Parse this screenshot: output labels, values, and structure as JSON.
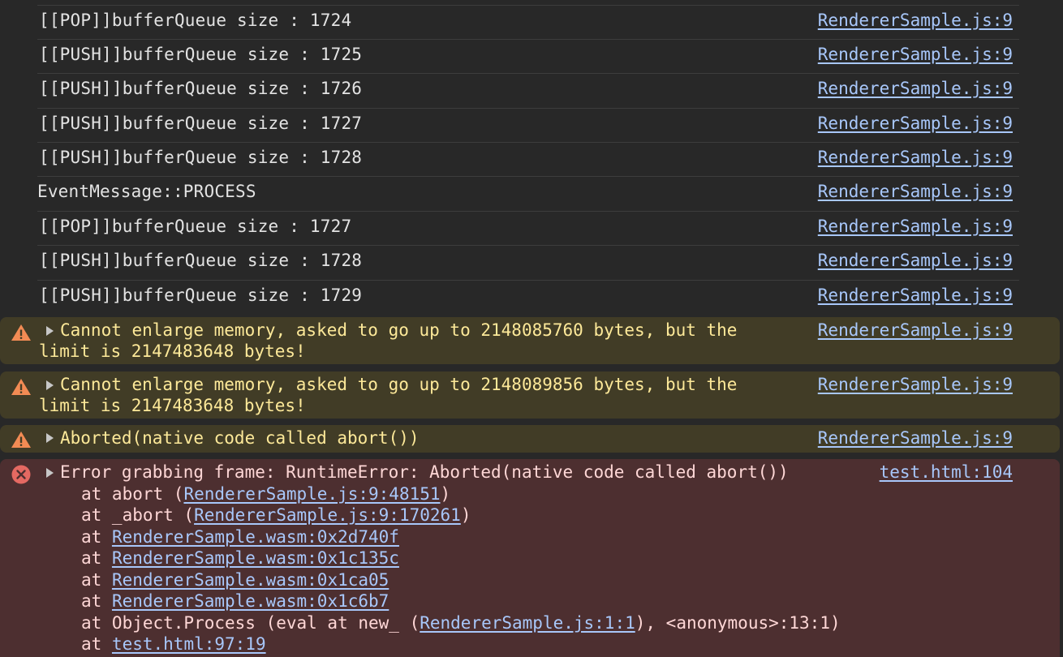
{
  "colors": {
    "background": "#282828",
    "text": "#e3e3e3",
    "link": "#a8c7fa",
    "warning_bg": "#413c26",
    "warning_text": "#fde999",
    "warning_icon": "#f28b54",
    "error_bg": "#4d2f30",
    "error_text": "#fed7d6",
    "error_icon": "#e46962"
  },
  "logs": [
    {
      "message": "[[POP]]bufferQueue size : 1724",
      "source": "RendererSample.js:9"
    },
    {
      "message": "[[PUSH]]bufferQueue size : 1725",
      "source": "RendererSample.js:9"
    },
    {
      "message": "[[PUSH]]bufferQueue size : 1726",
      "source": "RendererSample.js:9"
    },
    {
      "message": "[[PUSH]]bufferQueue size : 1727",
      "source": "RendererSample.js:9"
    },
    {
      "message": "[[PUSH]]bufferQueue size : 1728",
      "source": "RendererSample.js:9"
    },
    {
      "message": "EventMessage::PROCESS",
      "source": "RendererSample.js:9"
    },
    {
      "message": "[[POP]]bufferQueue size : 1727",
      "source": "RendererSample.js:9"
    },
    {
      "message": "[[PUSH]]bufferQueue size : 1728",
      "source": "RendererSample.js:9"
    },
    {
      "message": "[[PUSH]]bufferQueue size : 1729",
      "source": "RendererSample.js:9"
    }
  ],
  "warnings": [
    {
      "line1": "Cannot enlarge memory, asked to go up to 2148085760 bytes, but the",
      "line2": "limit is 2147483648 bytes!",
      "source": "RendererSample.js:9",
      "icon": "warning-triangle-icon"
    },
    {
      "line1": "Cannot enlarge memory, asked to go up to 2148089856 bytes, but the",
      "line2": "limit is 2147483648 bytes!",
      "source": "RendererSample.js:9",
      "icon": "warning-triangle-icon"
    },
    {
      "line1": "Aborted(native code called abort())",
      "source": "RendererSample.js:9",
      "icon": "warning-triangle-icon"
    }
  ],
  "error": {
    "icon": "error-circle-icon",
    "message": "Error grabbing frame: RuntimeError: Aborted(native code called abort())",
    "source": "test.html:104",
    "stack": {
      "l1_pre": "at abort (",
      "l1_link": "RendererSample.js:9:48151",
      "l1_post": ")",
      "l2_pre": "at _abort (",
      "l2_link": "RendererSample.js:9:170261",
      "l2_post": ")",
      "l3_pre": "at ",
      "l3_link": "RendererSample.wasm:0x2d740f",
      "l4_pre": "at ",
      "l4_link": "RendererSample.wasm:0x1c135c",
      "l5_pre": "at ",
      "l5_link": "RendererSample.wasm:0x1ca05",
      "l6_pre": "at ",
      "l6_link": "RendererSample.wasm:0x1c6b7",
      "l7_pre": "at Object.Process (eval at new_ (",
      "l7_link": "RendererSample.js:1:1",
      "l7_post": "), <anonymous>:13:1)",
      "l8_pre": "at ",
      "l8_link": "test.html:97:19"
    }
  }
}
